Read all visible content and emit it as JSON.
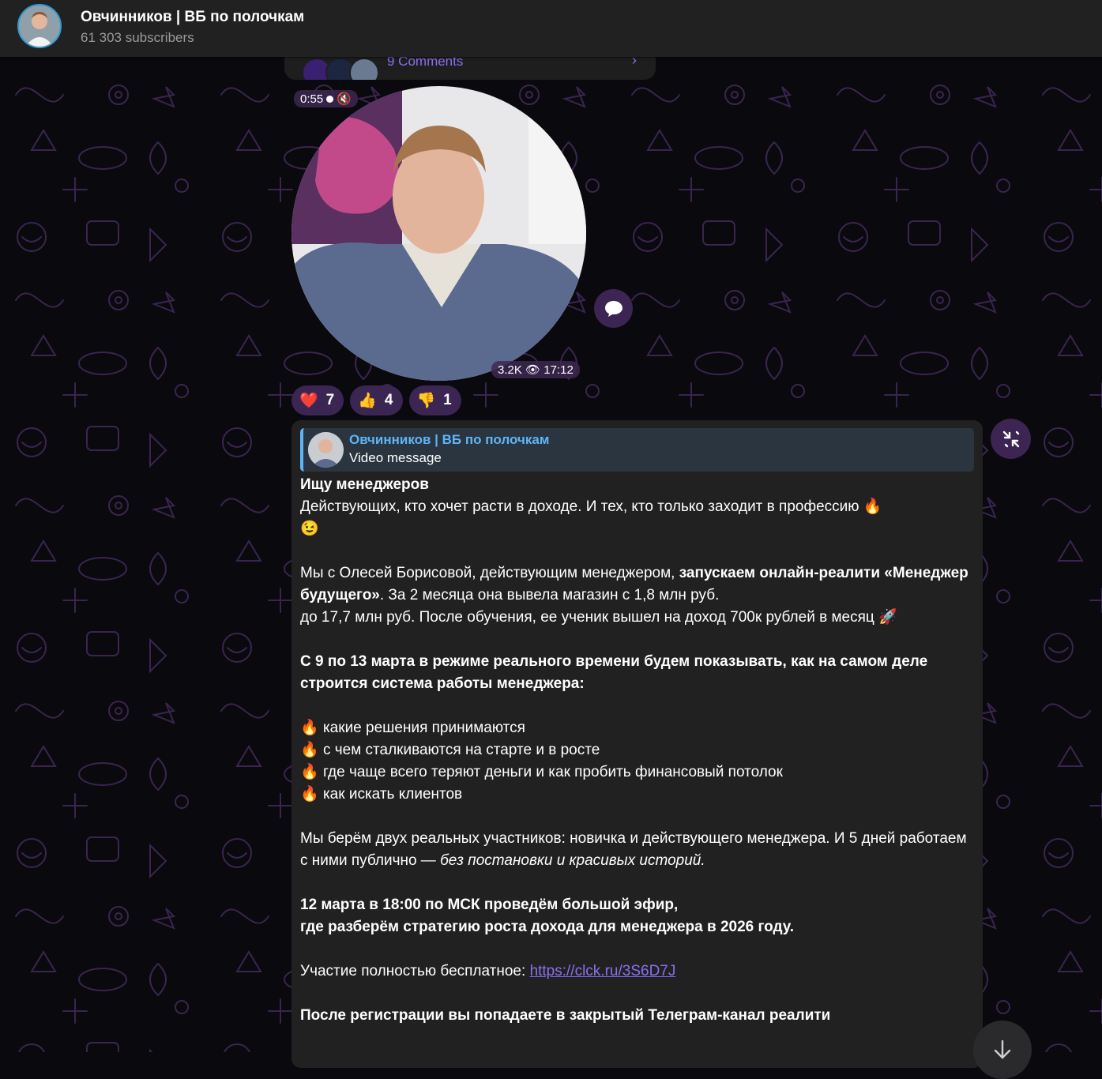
{
  "header": {
    "title": "Овчинников | ВБ по полочкам",
    "subtitle": "61 303 subscribers"
  },
  "comments_bar": {
    "label": "9 Comments"
  },
  "video": {
    "duration": "0:55",
    "views": "3.2K",
    "time": "17:12",
    "muted_icon": "muted-speaker-icon"
  },
  "reactions": [
    {
      "emoji": "❤️",
      "count": "7",
      "icon": "heart-icon"
    },
    {
      "emoji": "👍",
      "count": "4",
      "icon": "thumbs-up-icon"
    },
    {
      "emoji": "👎",
      "count": "1",
      "icon": "thumbs-down-icon"
    }
  ],
  "reply": {
    "name": "Овчинников | ВБ по полочкам",
    "type": "Video message"
  },
  "post": {
    "heading": "Ищу менеджеров",
    "line1": "Действующих, кто хочет расти в доходе. И тех, кто только заходит в профессию",
    "p2_part1": "Мы с Олесей Борисовой, действующим менеджером, ",
    "p2_bold": "запускаем онлайн-реалити «Менеджер будущего»",
    "p2_part2": ". За 2 месяца она вывела магазин с 1,8 млн руб.",
    "p2_line2": "до 17,7 млн руб. После обучения, ее ученик вышел на доход 700к рублей в месяц",
    "p3_bold": "С 9 по 13 марта в режиме реального времени будем показывать, как на самом деле строится система работы менеджера:",
    "bullets": [
      "какие решения принимаются",
      "с чем сталкиваются на старте и в росте",
      "где чаще всего теряют деньги и как пробить финансовый потолок",
      "как искать клиентов"
    ],
    "p5_part1": "Мы берём двух реальных участников: новичка и действующего менеджера. И 5 дней работаем с ними публично — ",
    "p5_italic": "без постановки и красивых историй.",
    "p6_line1": "12 марта в 18:00 по МСК проведём большой эфир,",
    "p6_line2": "где разберём стратегию роста дохода для менеджера в 2026 году.",
    "p7_text": "Участие полностью бесплатное: ",
    "p7_link": "https://clck.ru/3S6D7J",
    "p8_bold": "После регистрации вы попадаете в закрытый Телеграм-канал реалити"
  },
  "emojis": {
    "fire": "🔥",
    "wink": "😉",
    "rocket": "🚀"
  },
  "colors": {
    "accent": "#8b6ff0",
    "reply_accent": "#5eb5f7",
    "bubble": "#212121",
    "reaction_bg": "#3a2553"
  }
}
